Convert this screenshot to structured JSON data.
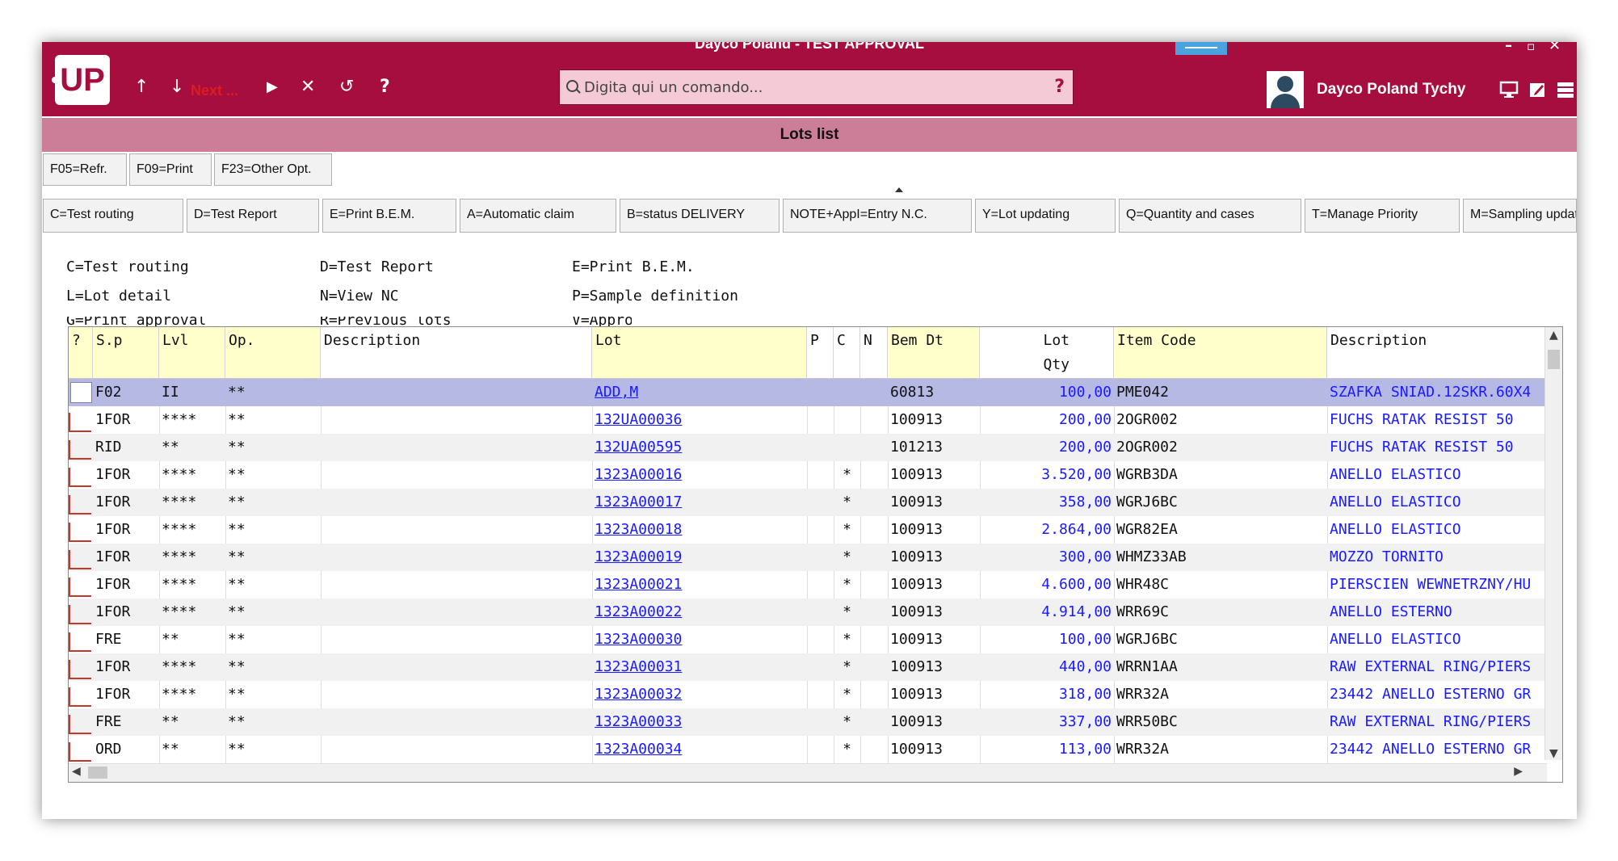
{
  "window": {
    "title": "Dayco Poland - TEST APPROVAL"
  },
  "toolbar": {
    "next_label": "Next ...",
    "command_placeholder": "Digita qui un comando...",
    "help_label": "?",
    "user_name": "Dayco Poland Tychy"
  },
  "logo_text": "UP",
  "screen_title": "Lots list",
  "function_keys": [
    {
      "label": "F05=Refr."
    },
    {
      "label": "F09=Print"
    },
    {
      "label": "F23=Other Opt."
    }
  ],
  "options_bar": [
    {
      "label": "C=Test routing"
    },
    {
      "label": "D=Test Report"
    },
    {
      "label": "E=Print B.E.M."
    },
    {
      "label": "A=Automatic claim"
    },
    {
      "label": "B=status DELIVERY"
    },
    {
      "label": "NOTE+AppI=Entry N.C."
    },
    {
      "label": "Y=Lot updating"
    },
    {
      "label": "Q=Quantity and cases"
    },
    {
      "label": "T=Manage Priority"
    },
    {
      "label": "M=Sampling updati"
    }
  ],
  "legend": {
    "line1": [
      "C=Test routing",
      "D=Test Report",
      "E=Print B.E.M."
    ],
    "line2": [
      "L=Lot detail",
      "N=View NC",
      "P=Sample definition"
    ],
    "line3": [
      "G=Print approval",
      "R=Previous lots",
      "V=Approval display"
    ]
  },
  "table": {
    "headers": {
      "sel": "?",
      "sp": "S.p",
      "lvl": "Lvl",
      "op": "Op.",
      "desc": "Description",
      "lot": "Lot",
      "p": "P",
      "c": "C",
      "n": "N",
      "bemdt": "Bem Dt",
      "lotqty1": "Lot",
      "lotqty2": "Qty",
      "item": "Item Code",
      "desc2": "Description"
    },
    "rows": [
      {
        "sp": "F02",
        "lvl": "II",
        "op": "**",
        "lot": "ADD,M",
        "c": "",
        "bem": "60813",
        "qty": "100,00",
        "item": "PME042",
        "desc2": "SZAFKA SNIAD.12SKR.60X4"
      },
      {
        "sp": "1FOR",
        "lvl": "****",
        "op": "**",
        "lot": "132UA00036",
        "c": "",
        "bem": "100913",
        "qty": "200,00",
        "item": "2OGR002",
        "desc2": "FUCHS RATAK RESIST 50"
      },
      {
        "sp": "RID",
        "lvl": "**",
        "op": "**",
        "lot": "132UA00595",
        "c": "",
        "bem": "101213",
        "qty": "200,00",
        "item": "2OGR002",
        "desc2": "FUCHS RATAK RESIST 50"
      },
      {
        "sp": "1FOR",
        "lvl": "****",
        "op": "**",
        "lot": "1323A00016",
        "c": "*",
        "bem": "100913",
        "qty": "3.520,00",
        "item": "WGRB3DA",
        "desc2": "ANELLO ELASTICO"
      },
      {
        "sp": "1FOR",
        "lvl": "****",
        "op": "**",
        "lot": "1323A00017",
        "c": "*",
        "bem": "100913",
        "qty": "358,00",
        "item": "WGRJ6BC",
        "desc2": "ANELLO ELASTICO"
      },
      {
        "sp": "1FOR",
        "lvl": "****",
        "op": "**",
        "lot": "1323A00018",
        "c": "*",
        "bem": "100913",
        "qty": "2.864,00",
        "item": "WGR82EA",
        "desc2": "ANELLO ELASTICO"
      },
      {
        "sp": "1FOR",
        "lvl": "****",
        "op": "**",
        "lot": "1323A00019",
        "c": "*",
        "bem": "100913",
        "qty": "300,00",
        "item": "WHMZ33AB",
        "desc2": "MOZZO TORNITO"
      },
      {
        "sp": "1FOR",
        "lvl": "****",
        "op": "**",
        "lot": "1323A00021",
        "c": "*",
        "bem": "100913",
        "qty": "4.600,00",
        "item": "WHR48C",
        "desc2": "PIERSCIEN WEWNETRZNY/HU"
      },
      {
        "sp": "1FOR",
        "lvl": "****",
        "op": "**",
        "lot": "1323A00022",
        "c": "*",
        "bem": "100913",
        "qty": "4.914,00",
        "item": "WRR69C",
        "desc2": "ANELLO ESTERNO"
      },
      {
        "sp": "FRE",
        "lvl": "**",
        "op": "**",
        "lot": "1323A00030",
        "c": "*",
        "bem": "100913",
        "qty": "100,00",
        "item": "WGRJ6BC",
        "desc2": "ANELLO ELASTICO"
      },
      {
        "sp": "1FOR",
        "lvl": "****",
        "op": "**",
        "lot": "1323A00031",
        "c": "*",
        "bem": "100913",
        "qty": "440,00",
        "item": "WRRN1AA",
        "desc2": "RAW EXTERNAL RING/PIERS"
      },
      {
        "sp": "1FOR",
        "lvl": "****",
        "op": "**",
        "lot": "1323A00032",
        "c": "*",
        "bem": "100913",
        "qty": "318,00",
        "item": "WRR32A",
        "desc2": "23442 ANELLO ESTERNO GR"
      },
      {
        "sp": "FRE",
        "lvl": "**",
        "op": "**",
        "lot": "1323A00033",
        "c": "*",
        "bem": "100913",
        "qty": "337,00",
        "item": "WRR50BC",
        "desc2": "RAW EXTERNAL RING/PIERS"
      },
      {
        "sp": "ORD",
        "lvl": "**",
        "op": "**",
        "lot": "1323A00034",
        "c": "*",
        "bem": "100913",
        "qty": "113,00",
        "item": "WRR32A",
        "desc2": "23442 ANELLO ESTERNO GR"
      }
    ]
  },
  "colors": {
    "titlebar": "#a50e3f",
    "header_band": "#cc7d97",
    "column_header": "#ffffcc",
    "selected_row": "#b7b9e5",
    "link": "#1a1aff"
  }
}
